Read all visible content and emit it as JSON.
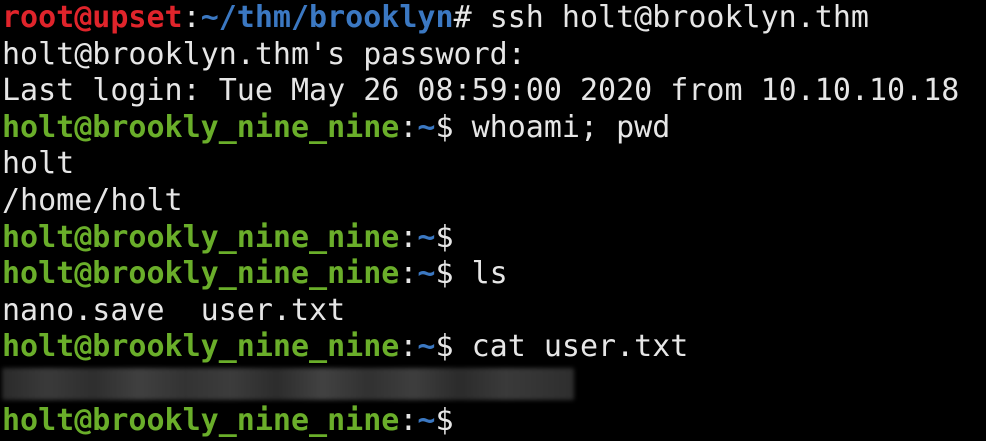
{
  "terminal": {
    "lines": [
      {
        "user": "root@upset",
        "sep": ":",
        "path": "~/thm/brooklyn",
        "prompt": "# ",
        "cmd": "ssh holt@brooklyn.thm"
      },
      {
        "out": "holt@brooklyn.thm's password:"
      },
      {
        "out": "Last login: Tue May 26 08:59:00 2020 from 10.10.10.18"
      },
      {
        "user": "holt@brookly_nine_nine",
        "sep": ":",
        "path": "~",
        "prompt": "$ ",
        "cmd": "whoami; pwd"
      },
      {
        "out": "holt"
      },
      {
        "out": "/home/holt"
      },
      {
        "user": "holt@brookly_nine_nine",
        "sep": ":",
        "path": "~",
        "prompt": "$",
        "cmd": ""
      },
      {
        "user": "holt@brookly_nine_nine",
        "sep": ":",
        "path": "~",
        "prompt": "$ ",
        "cmd": "ls"
      },
      {
        "out": "nano.save  user.txt"
      },
      {
        "user": "holt@brookly_nine_nine",
        "sep": ":",
        "path": "~",
        "prompt": "$ ",
        "cmd": "cat user.txt"
      },
      {
        "redacted": true
      },
      {
        "user": "holt@brookly_nine_nine",
        "sep": ":",
        "path": "~",
        "prompt": "$",
        "cmd": ""
      }
    ]
  },
  "colors": {
    "background": "#000000",
    "root_user": "#e0242b",
    "path": "#3b78c2",
    "holt_user": "#6aae2a",
    "text": "#e6e6e6"
  }
}
